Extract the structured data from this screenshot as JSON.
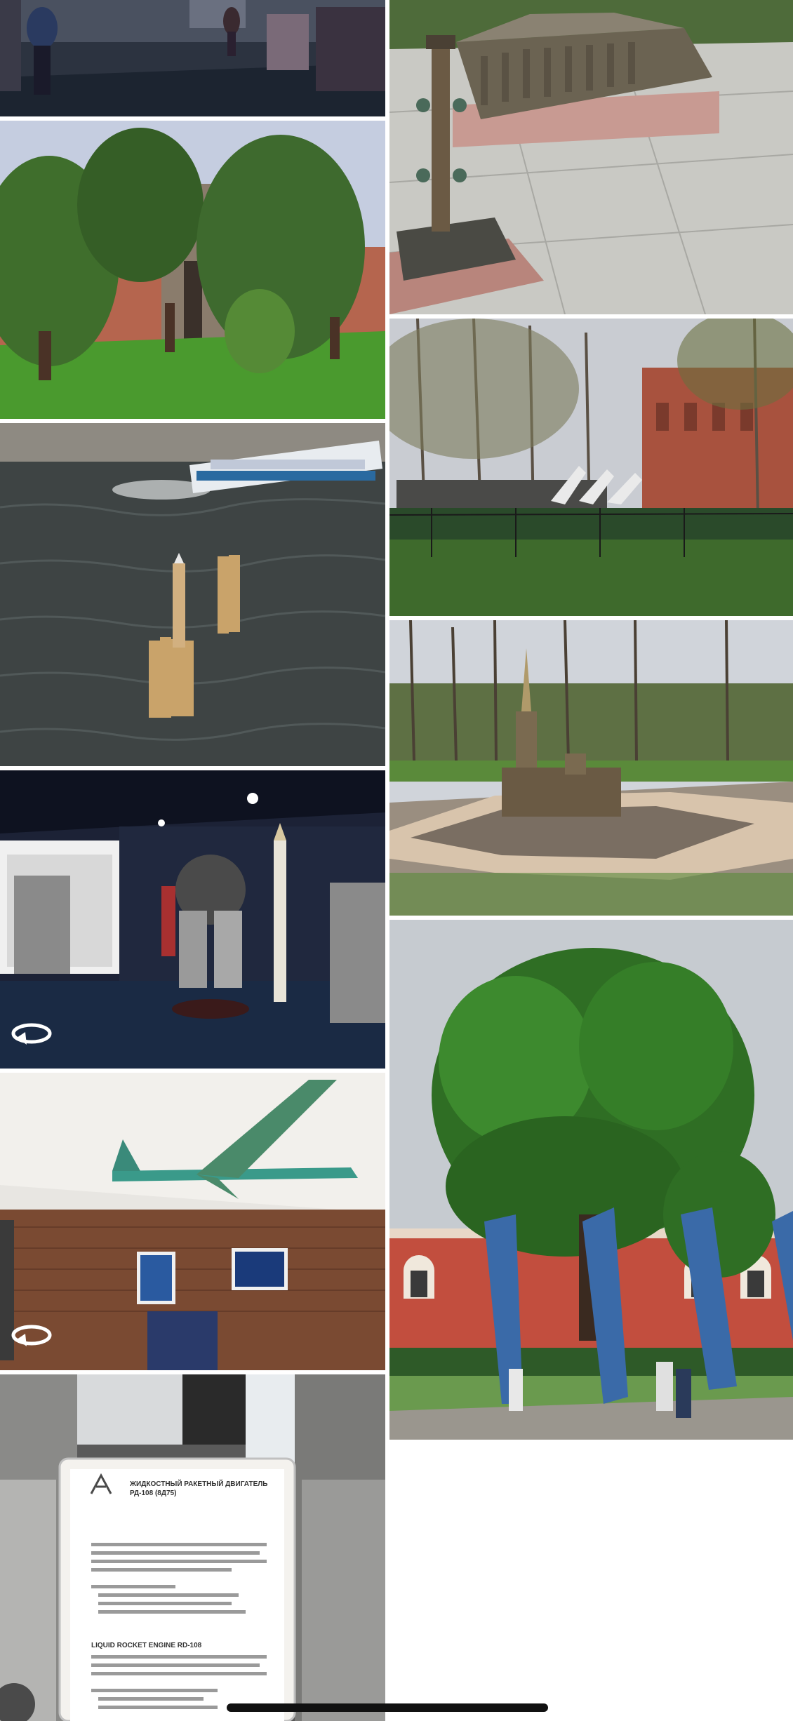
{
  "gallery": {
    "photos": [
      {
        "subject": "museum-hall-visitors"
      },
      {
        "subject": "fortress-model-miniature"
      },
      {
        "subject": "fortress-gate-with-trees"
      },
      {
        "subject": "artillery-museum-cannons"
      },
      {
        "subject": "river-tour-boat"
      },
      {
        "subject": "cathedral-model-miniature"
      },
      {
        "subject": "rocket-engine-exhibit",
        "panorama": true
      },
      {
        "subject": "oak-tree-with-banners"
      },
      {
        "subject": "missile-exhibit-hall",
        "panorama": true
      },
      {
        "subject": "engine-placard"
      }
    ],
    "panorama_icon": "rotate-360-icon",
    "placard": {
      "title_ru": "ЖИДКОСТНЫЙ РАКЕТНЫЙ ДВИГАТЕЛЬ РД-108 (8Д75)",
      "title_en": "LIQUID ROCKET ENGINE RD-108"
    }
  },
  "colors": {
    "background": "#ffffff",
    "home_indicator": "#111111"
  }
}
